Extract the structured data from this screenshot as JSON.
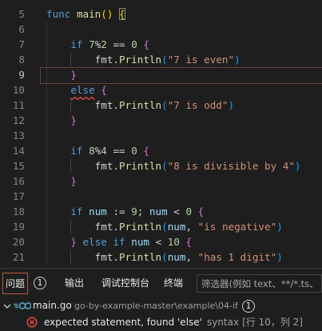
{
  "theme": {
    "background": "#1e1e1e",
    "line_number": "#858585",
    "active_line_number": "#c6c6c6",
    "current_line_border": "#6b4034",
    "error": "#f14c4c"
  },
  "editor": {
    "lines": [
      {
        "number": "5",
        "tokens": [
          {
            "t": "func",
            "c": "#569cd6"
          },
          {
            "t": " "
          },
          {
            "t": "main",
            "c": "#dcdcaa"
          },
          {
            "t": "()",
            "c": "#ffd700"
          },
          {
            "t": " "
          },
          {
            "t": "{",
            "c": "#ffd700",
            "bracket_match": true
          }
        ]
      },
      {
        "number": "6",
        "tokens": []
      },
      {
        "number": "7",
        "tokens": [
          {
            "t": "    "
          },
          {
            "t": "if",
            "c": "#569cd6"
          },
          {
            "t": " "
          },
          {
            "t": "7",
            "c": "#b5cea8"
          },
          {
            "t": "%",
            "c": "#d4d4d4"
          },
          {
            "t": "2",
            "c": "#b5cea8"
          },
          {
            "t": " == ",
            "c": "#d4d4d4"
          },
          {
            "t": "0",
            "c": "#b5cea8"
          },
          {
            "t": " "
          },
          {
            "t": "{",
            "c": "#da70d6"
          }
        ]
      },
      {
        "number": "8",
        "tokens": [
          {
            "t": "        "
          },
          {
            "t": "fmt",
            "c": "#d4d4d4"
          },
          {
            "t": ".",
            "c": "#d4d4d4"
          },
          {
            "t": "Println",
            "c": "#dcdcaa"
          },
          {
            "t": "(",
            "c": "#179fff"
          },
          {
            "t": "\"7 is even\"",
            "c": "#ce9178"
          },
          {
            "t": ")",
            "c": "#179fff"
          }
        ]
      },
      {
        "number": "9",
        "active": true,
        "tokens": [
          {
            "t": "    "
          },
          {
            "t": "}",
            "c": "#da70d6"
          }
        ]
      },
      {
        "number": "10",
        "tokens": [
          {
            "t": "    "
          },
          {
            "t": "else",
            "c": "#569cd6",
            "squiggle": true
          },
          {
            "t": " "
          },
          {
            "t": "{",
            "c": "#da70d6"
          }
        ]
      },
      {
        "number": "11",
        "tokens": [
          {
            "t": "        "
          },
          {
            "t": "fmt",
            "c": "#d4d4d4"
          },
          {
            "t": ".",
            "c": "#d4d4d4"
          },
          {
            "t": "Println",
            "c": "#dcdcaa"
          },
          {
            "t": "(",
            "c": "#179fff"
          },
          {
            "t": "\"7 is odd\"",
            "c": "#ce9178"
          },
          {
            "t": ")",
            "c": "#179fff"
          }
        ]
      },
      {
        "number": "12",
        "tokens": [
          {
            "t": "    "
          },
          {
            "t": "}",
            "c": "#da70d6"
          }
        ]
      },
      {
        "number": "13",
        "tokens": []
      },
      {
        "number": "14",
        "tokens": [
          {
            "t": "    "
          },
          {
            "t": "if",
            "c": "#569cd6"
          },
          {
            "t": " "
          },
          {
            "t": "8",
            "c": "#b5cea8"
          },
          {
            "t": "%",
            "c": "#d4d4d4"
          },
          {
            "t": "4",
            "c": "#b5cea8"
          },
          {
            "t": " == ",
            "c": "#d4d4d4"
          },
          {
            "t": "0",
            "c": "#b5cea8"
          },
          {
            "t": " "
          },
          {
            "t": "{",
            "c": "#da70d6"
          }
        ]
      },
      {
        "number": "15",
        "tokens": [
          {
            "t": "        "
          },
          {
            "t": "fmt",
            "c": "#d4d4d4"
          },
          {
            "t": ".",
            "c": "#d4d4d4"
          },
          {
            "t": "Println",
            "c": "#dcdcaa"
          },
          {
            "t": "(",
            "c": "#179fff"
          },
          {
            "t": "\"8 is divisible by 4\"",
            "c": "#ce9178"
          },
          {
            "t": ")",
            "c": "#179fff"
          }
        ]
      },
      {
        "number": "16",
        "tokens": [
          {
            "t": "    "
          },
          {
            "t": "}",
            "c": "#da70d6"
          }
        ]
      },
      {
        "number": "17",
        "tokens": []
      },
      {
        "number": "18",
        "tokens": [
          {
            "t": "    "
          },
          {
            "t": "if",
            "c": "#569cd6"
          },
          {
            "t": " "
          },
          {
            "t": "num",
            "c": "#9cdcfe"
          },
          {
            "t": " := ",
            "c": "#d4d4d4"
          },
          {
            "t": "9",
            "c": "#b5cea8"
          },
          {
            "t": "; ",
            "c": "#d4d4d4"
          },
          {
            "t": "num",
            "c": "#9cdcfe"
          },
          {
            "t": " < ",
            "c": "#d4d4d4"
          },
          {
            "t": "0",
            "c": "#b5cea8"
          },
          {
            "t": " "
          },
          {
            "t": "{",
            "c": "#da70d6"
          }
        ]
      },
      {
        "number": "19",
        "tokens": [
          {
            "t": "        "
          },
          {
            "t": "fmt",
            "c": "#d4d4d4"
          },
          {
            "t": ".",
            "c": "#d4d4d4"
          },
          {
            "t": "Println",
            "c": "#dcdcaa"
          },
          {
            "t": "(",
            "c": "#179fff"
          },
          {
            "t": "num",
            "c": "#9cdcfe"
          },
          {
            "t": ", ",
            "c": "#d4d4d4"
          },
          {
            "t": "\"is negative\"",
            "c": "#ce9178"
          },
          {
            "t": ")",
            "c": "#179fff"
          }
        ]
      },
      {
        "number": "20",
        "tokens": [
          {
            "t": "    "
          },
          {
            "t": "}",
            "c": "#da70d6"
          },
          {
            "t": " "
          },
          {
            "t": "else",
            "c": "#569cd6"
          },
          {
            "t": " "
          },
          {
            "t": "if",
            "c": "#569cd6"
          },
          {
            "t": " "
          },
          {
            "t": "num",
            "c": "#9cdcfe"
          },
          {
            "t": " < ",
            "c": "#d4d4d4"
          },
          {
            "t": "10",
            "c": "#b5cea8"
          },
          {
            "t": " "
          },
          {
            "t": "{",
            "c": "#da70d6"
          }
        ]
      },
      {
        "number": "21",
        "tokens": [
          {
            "t": "        "
          },
          {
            "t": "fmt",
            "c": "#d4d4d4"
          },
          {
            "t": ".",
            "c": "#d4d4d4"
          },
          {
            "t": "Println",
            "c": "#dcdcaa"
          },
          {
            "t": "(",
            "c": "#179fff"
          },
          {
            "t": "num",
            "c": "#9cdcfe"
          },
          {
            "t": ", ",
            "c": "#d4d4d4"
          },
          {
            "t": "\"has 1 digit\"",
            "c": "#ce9178"
          },
          {
            "t": ")",
            "c": "#179fff"
          }
        ]
      }
    ]
  },
  "panel": {
    "tabs": [
      {
        "label": "问题",
        "active": true
      },
      {
        "label": "输出"
      },
      {
        "label": "调试控制台"
      },
      {
        "label": "终端"
      }
    ],
    "problems_count": "1",
    "filter_placeholder": "筛选器(例如 text、**/*.ts、!*"
  },
  "problems": {
    "file": {
      "icon": "go-file-icon",
      "expanded": true,
      "name": "main.go",
      "path": "go-by-example-master\\example\\04-if",
      "count": "1"
    },
    "items": [
      {
        "icon": "error-icon",
        "message": "expected statement, found 'else'",
        "source": "syntax",
        "location": "[行 10，列 2]"
      }
    ]
  }
}
